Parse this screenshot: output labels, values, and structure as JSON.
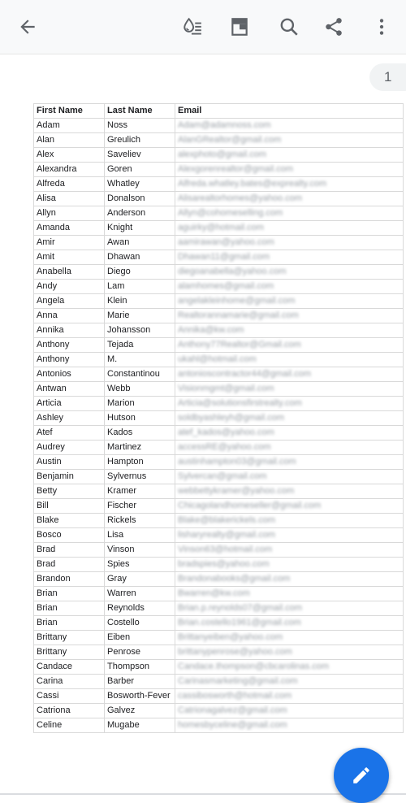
{
  "toolbar": {
    "icons": [
      "back-arrow-icon",
      "color-fill-icon",
      "freeze-icon",
      "search-icon",
      "share-icon",
      "more-vert-icon"
    ]
  },
  "page_indicator": "1",
  "sheet": {
    "headers": [
      "First Name",
      "Last Name",
      "Email"
    ],
    "rows": [
      [
        "Adam",
        "Noss",
        "Adam@adamnoss.com"
      ],
      [
        "Alan",
        "Greulich",
        "AlanGRealtor@gmail.com"
      ],
      [
        "Alex",
        "Saveliev",
        "alexphoto@gmail.com"
      ],
      [
        "Alexandra",
        "Goren",
        "Alexgorenrealtor@gmail.com"
      ],
      [
        "Alfreda",
        "Whatley",
        "Alfreda.whatley.bates@exprealty.com"
      ],
      [
        "Alisa",
        "Donalson",
        "Alisarealtorhomes@yahoo.com"
      ],
      [
        "Allyn",
        "Anderson",
        "Allyn@cohomeselling.com"
      ],
      [
        "Amanda",
        "Knight",
        "aguirky@hotmail.com"
      ],
      [
        "Amir",
        "Awan",
        "aamirawan@yahoo.com"
      ],
      [
        "Amit",
        "Dhawan",
        "Dhawan11@gmail.com"
      ],
      [
        "Anabella",
        "Diego",
        "diegoanabella@yahoo.com"
      ],
      [
        "Andy",
        "Lam",
        "alamhomes@gmail.com"
      ],
      [
        "Angela",
        "Klein",
        "angelakleinhome@gmail.com"
      ],
      [
        "Anna",
        "Marie",
        "Realtorannamarie@gmail.com"
      ],
      [
        "Annika",
        "Johansson",
        "Annika@kw.com"
      ],
      [
        "Anthony",
        "Tejada",
        "Anthony77Realtor@Gmail.com"
      ],
      [
        "Anthony",
        "M.",
        "ukahl@hotmail.com"
      ],
      [
        "Antonios",
        "Constantinou",
        "antonioscontractor44@gmail.com"
      ],
      [
        "Antwan",
        "Webb",
        "Visionmgmt@gmail.com"
      ],
      [
        "Articia",
        "Marion",
        "Articia@solutionsfirstrealty.com"
      ],
      [
        "Ashley",
        "Hutson",
        "soldbyashleyh@gmail.com"
      ],
      [
        "Atef",
        "Kados",
        "atef_kados@yahoo.com"
      ],
      [
        "Audrey",
        "Martinez",
        "accessRE@yahoo.com"
      ],
      [
        "Austin",
        "Hampton",
        "austinhampton03@gmail.com"
      ],
      [
        "Benjamin",
        "Sylvernus",
        "Sylvercan@gmail.com"
      ],
      [
        "Betty",
        "Kramer",
        "webbettykramer@yahoo.com"
      ],
      [
        "Bill",
        "Fischer",
        "Chicagolandhomeseller@gmail.com"
      ],
      [
        "Blake",
        "Rickels",
        "Blake@blakerickels.com"
      ],
      [
        "Bosco",
        "Lisa",
        "lisharyrealty@gmail.com"
      ],
      [
        "Brad",
        "Vinson",
        "Vinson63@hotmail.com"
      ],
      [
        "Brad",
        "Spies",
        "bradspies@yahoo.com"
      ],
      [
        "Brandon",
        "Gray",
        "Brandonabooks@gmail.com"
      ],
      [
        "Brian",
        "Warren",
        "Bwarren@kw.com"
      ],
      [
        "Brian",
        "Reynolds",
        "Brian.p.reynolds07@gmail.com"
      ],
      [
        "Brian",
        "Costello",
        "Brian.costello1961@gmail.com"
      ],
      [
        "Brittany",
        "Eiben",
        "Brittanyeiben@yahoo.com"
      ],
      [
        "Brittany",
        "Penrose",
        "brittanypenrose@yahoo.com"
      ],
      [
        "Candace",
        "Thompson",
        "Candace.thompson@cbcarolinas.com"
      ],
      [
        "Carina",
        "Barber",
        "Carinasmarketing@gmail.com"
      ],
      [
        "Cassi",
        "Bosworth-Fever",
        "cassibosworth@hotmail.com"
      ],
      [
        "Catriona",
        "Galvez",
        "Catrionagalvez@gmail.com"
      ],
      [
        "Celine",
        "Mugabe",
        "homesbyceline@gmail.com"
      ]
    ]
  },
  "fab": {
    "icon": "pencil-icon",
    "color": "#1a73e8"
  }
}
